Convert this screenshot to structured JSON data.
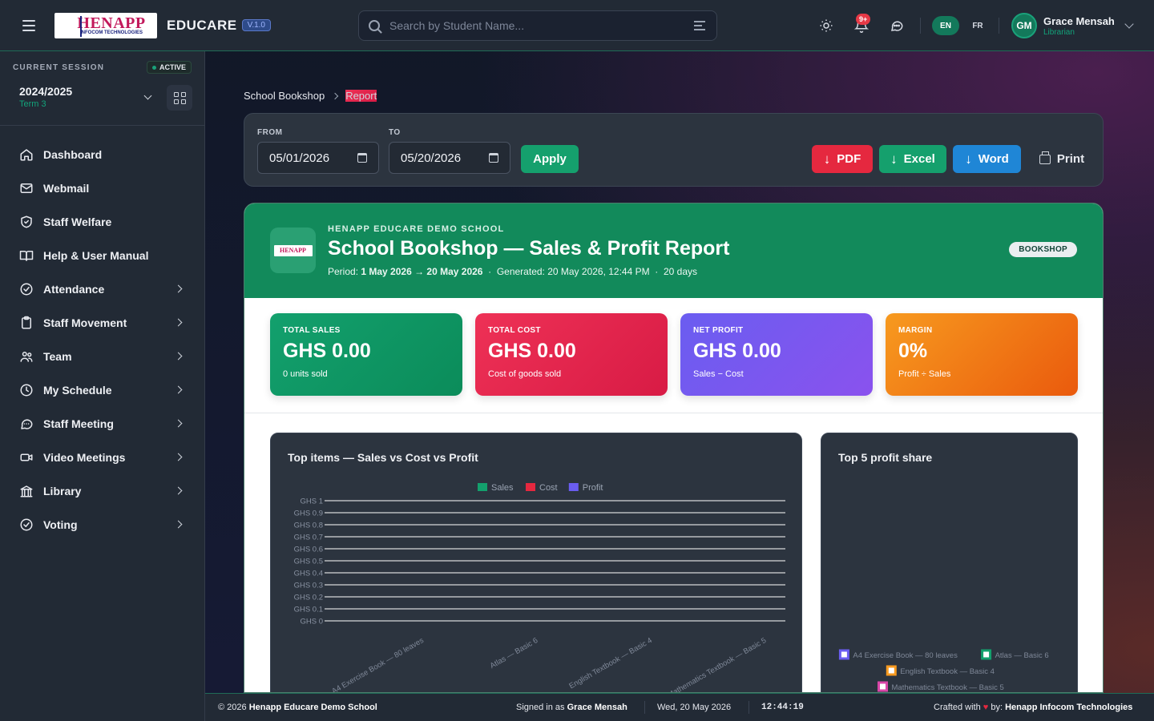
{
  "app": {
    "brand": "EDUCARE",
    "version": "V.1.0",
    "logo_text": "HENAPP",
    "logo_sub": "INFOCOM TECHNOLOGIES"
  },
  "search": {
    "placeholder": "Search by Student Name..."
  },
  "header": {
    "notif_badge": "9+",
    "lang": [
      "EN",
      "FR"
    ],
    "lang_active": "EN"
  },
  "user": {
    "initials": "GM",
    "name": "Grace Mensah",
    "role": "Librarian"
  },
  "session": {
    "label": "CURRENT SESSION",
    "status": "ACTIVE",
    "year": "2024/2025",
    "term": "Term 3"
  },
  "sidebar": {
    "items": [
      {
        "label": "Dashboard",
        "icon": "home-icon",
        "has_children": false
      },
      {
        "label": "Webmail",
        "icon": "mail-icon",
        "has_children": false
      },
      {
        "label": "Staff Welfare",
        "icon": "shield-icon",
        "has_children": false
      },
      {
        "label": "Help & User Manual",
        "icon": "book-icon",
        "has_children": false
      },
      {
        "label": "Attendance",
        "icon": "check-circle-icon",
        "has_children": true
      },
      {
        "label": "Staff Movement",
        "icon": "clipboard-icon",
        "has_children": true
      },
      {
        "label": "Team",
        "icon": "users-icon",
        "has_children": true
      },
      {
        "label": "My Schedule",
        "icon": "clock-icon",
        "has_children": true
      },
      {
        "label": "Staff Meeting",
        "icon": "chat-icon",
        "has_children": true
      },
      {
        "label": "Video Meetings",
        "icon": "video-icon",
        "has_children": true
      },
      {
        "label": "Library",
        "icon": "library-icon",
        "has_children": true
      },
      {
        "label": "Voting",
        "icon": "check-circle-icon",
        "has_children": true
      }
    ]
  },
  "breadcrumb": [
    "School Bookshop",
    "Report"
  ],
  "filters": {
    "from_label": "FROM",
    "from_value": "05/01/2026",
    "to_label": "TO",
    "to_value": "05/20/2026",
    "apply": "Apply",
    "pdf": "PDF",
    "excel": "Excel",
    "word": "Word",
    "print": "Print"
  },
  "report": {
    "school": "HENAPP EDUCARE DEMO SCHOOL",
    "title": "School Bookshop — Sales & Profit Report",
    "period_label": "Period:",
    "period": "1 May 2026 → 20 May 2026",
    "generated": "Generated: 20 May 2026, 12:44 PM",
    "days": "20 days",
    "tag": "BOOKSHOP"
  },
  "stats": [
    {
      "label": "TOTAL SALES",
      "value": "GHS 0.00",
      "sub": "0 units sold"
    },
    {
      "label": "TOTAL COST",
      "value": "GHS 0.00",
      "sub": "Cost of goods sold"
    },
    {
      "label": "NET PROFIT",
      "value": "GHS 0.00",
      "sub": "Sales − Cost"
    },
    {
      "label": "MARGIN",
      "value": "0%",
      "sub": "Profit ÷ Sales"
    }
  ],
  "chart_title": "Top items — Sales vs Cost vs Profit",
  "pie_title": "Top 5 profit share",
  "chart_data": [
    {
      "type": "bar",
      "title": "Top items — Sales vs Cost vs Profit",
      "categories": [
        "A4 Exercise Book — 80 leaves",
        "Atlas — Basic 6",
        "English Textbook — Basic 4",
        "Mathematics Textbook — Basic 5"
      ],
      "series": [
        {
          "name": "Sales",
          "values": [
            0,
            0,
            0,
            0
          ],
          "color": "#13a06d"
        },
        {
          "name": "Cost",
          "values": [
            0,
            0,
            0,
            0
          ],
          "color": "#e5283f"
        },
        {
          "name": "Profit",
          "values": [
            0,
            0,
            0,
            0
          ],
          "color": "#6a5df0"
        }
      ],
      "yticks": [
        "GHS 0",
        "GHS 0.1",
        "GHS 0.2",
        "GHS 0.3",
        "GHS 0.4",
        "GHS 0.5",
        "GHS 0.6",
        "GHS 0.7",
        "GHS 0.8",
        "GHS 0.9",
        "GHS 1"
      ],
      "ylim": [
        0,
        1
      ],
      "grid": true,
      "legend": "top"
    },
    {
      "type": "pie",
      "title": "Top 5 profit share",
      "labels": [
        "A4 Exercise Book — 80 leaves",
        "Atlas — Basic 6",
        "English Textbook — Basic 4",
        "Mathematics Textbook — Basic 5"
      ],
      "values": [
        0,
        0,
        0,
        0
      ],
      "colors": [
        "#6a5df0",
        "#13a06d",
        "#f79a1f",
        "#d946a8"
      ],
      "legend": "bottom"
    }
  ],
  "footer": {
    "copyright": "© 2026",
    "school": "Henapp Educare Demo School",
    "signed_in": "Signed in as",
    "user": "Grace Mensah",
    "date": "Wed, 20 May 2026",
    "time": "12:44:19",
    "crafted": "Crafted with",
    "by": "by:",
    "company": "Henapp Infocom Technologies"
  }
}
